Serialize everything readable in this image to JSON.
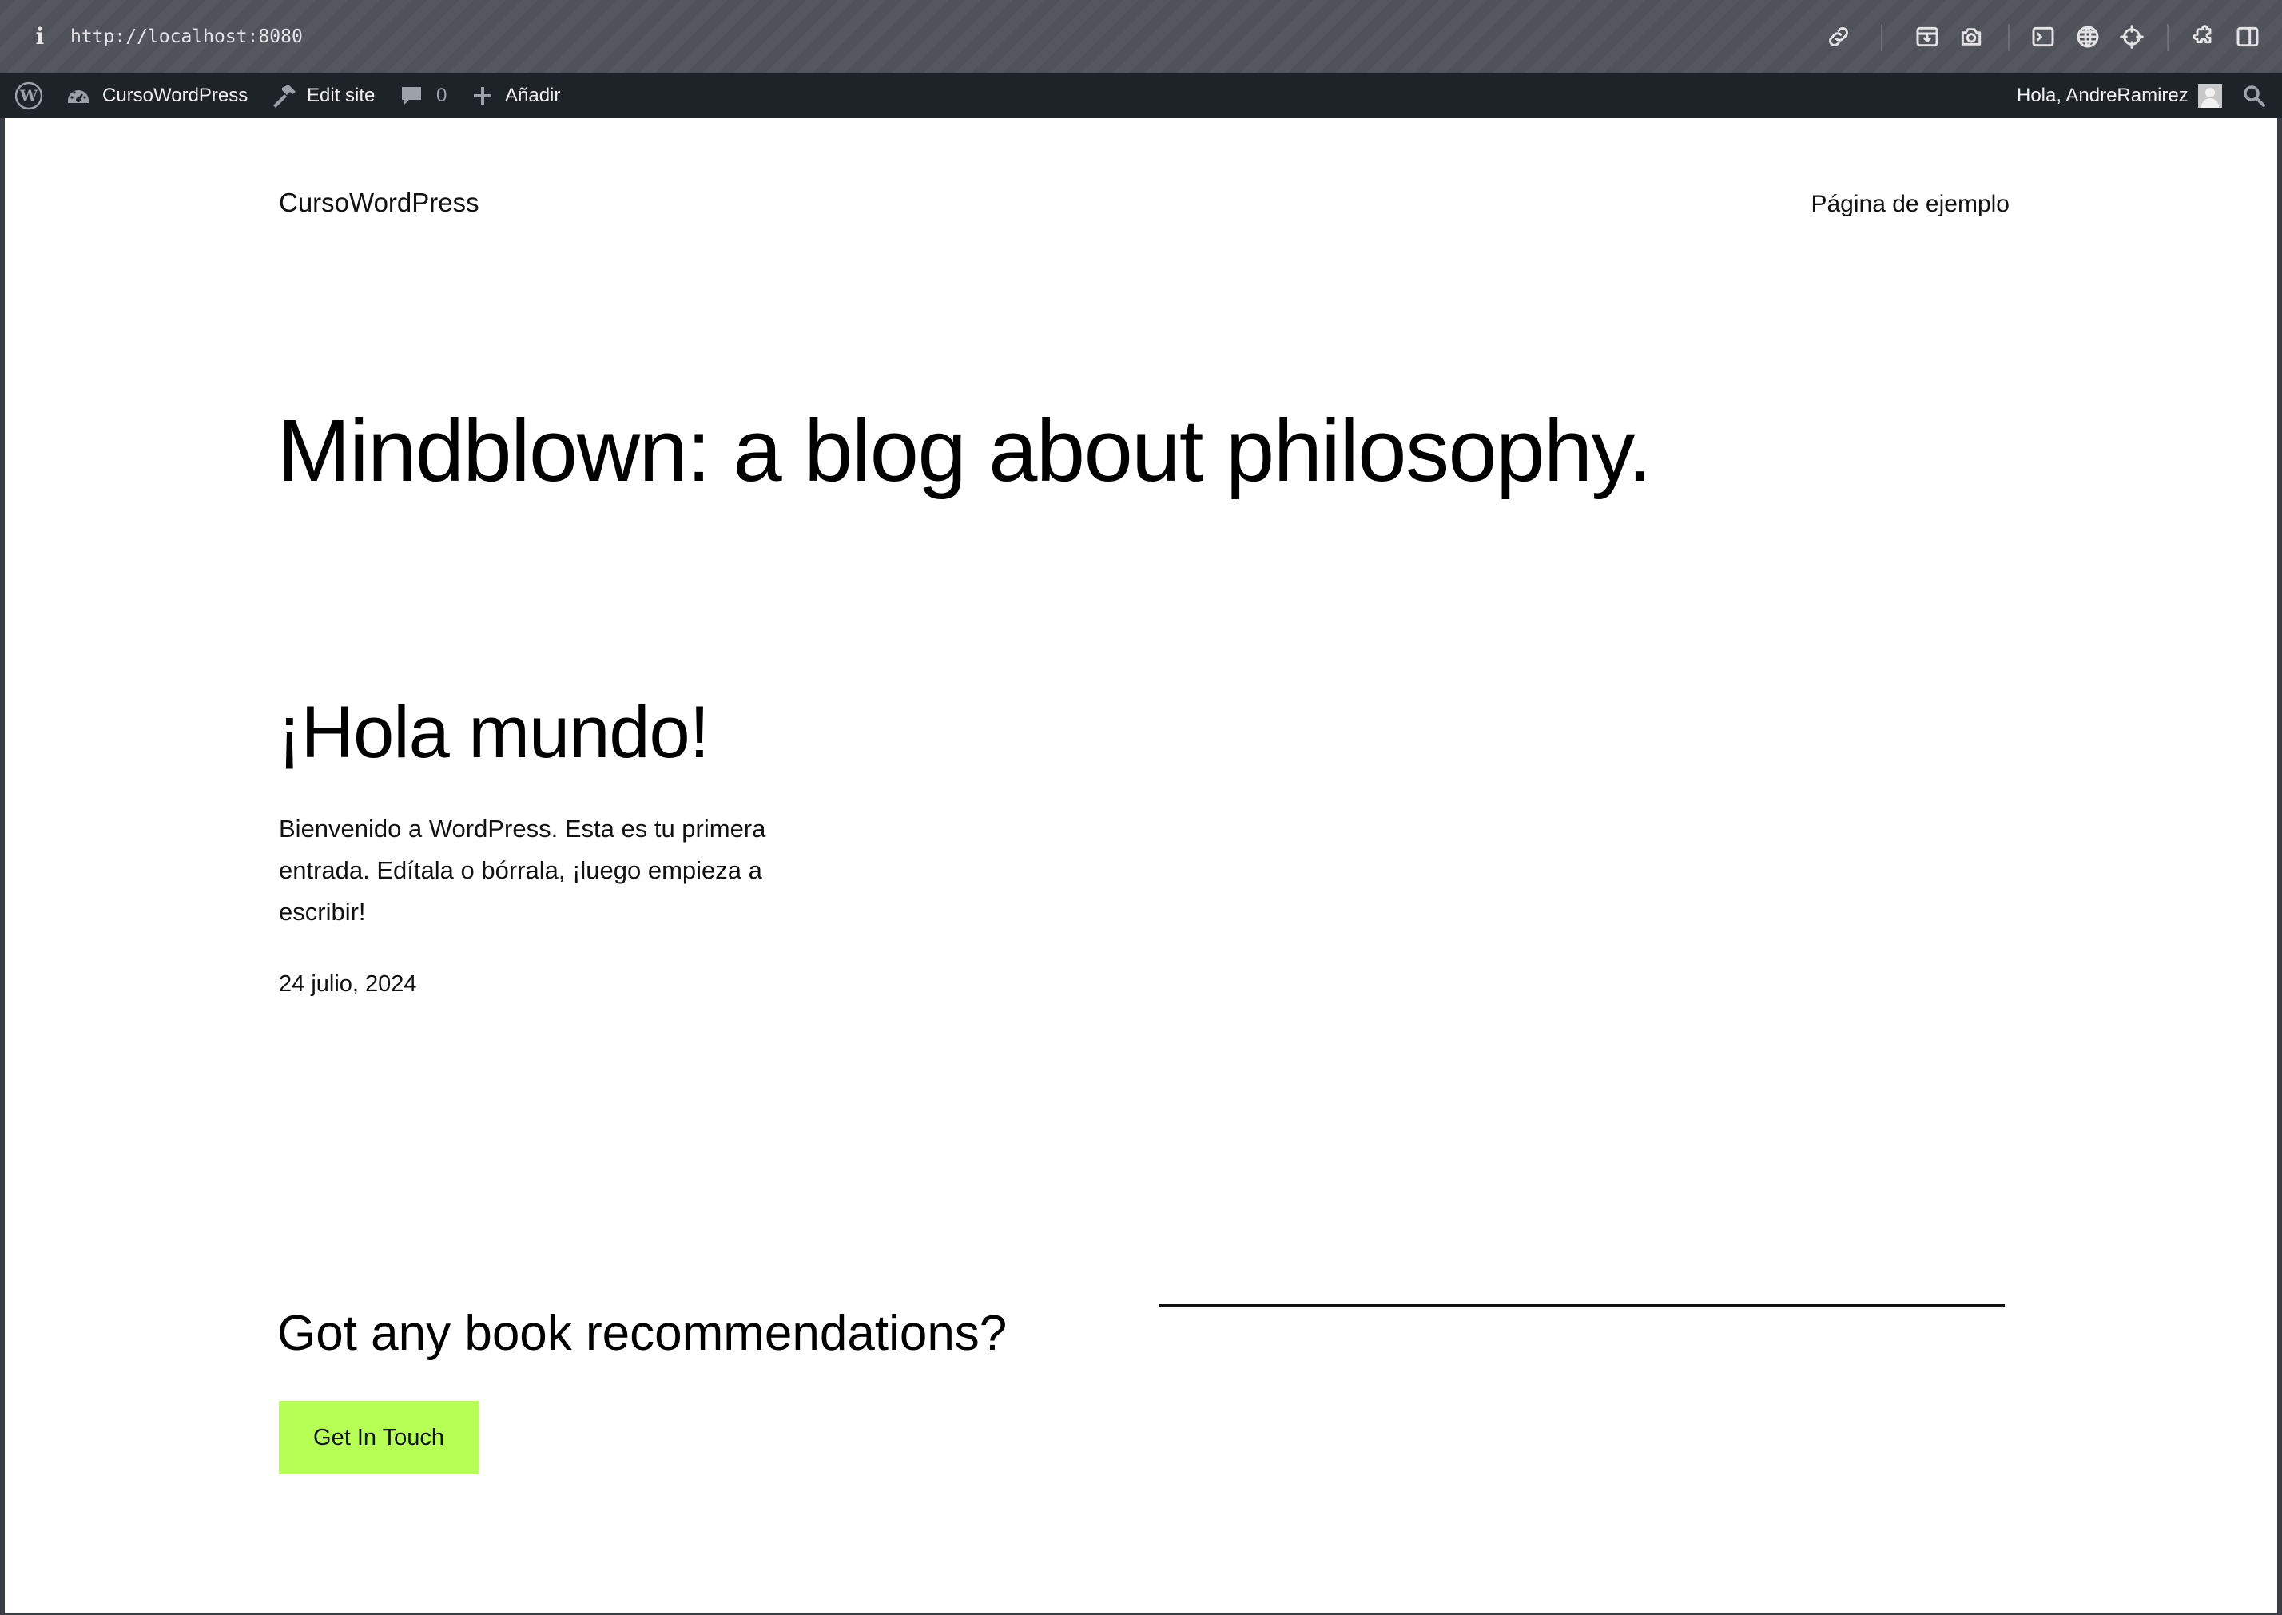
{
  "browser": {
    "info_glyph": "i",
    "url": "http://localhost:8080",
    "toolbar_icons": [
      "link-icon",
      "screenshot-area-icon",
      "camera-icon",
      "terminal-icon",
      "globe-icon",
      "crosshair-icon",
      "extensions-icon",
      "sidebar-icon"
    ]
  },
  "admin_bar": {
    "site_name": "CursoWordPress",
    "edit_site": "Edit site",
    "comments_count": "0",
    "add_new": "Añadir",
    "greeting": "Hola, AndreRamirez"
  },
  "site": {
    "title": "CursoWordPress",
    "nav_link": "Página de ejemplo",
    "hero_heading": "Mindblown: a blog about philosophy."
  },
  "post": {
    "title": "¡Hola mundo!",
    "excerpt": "Bienvenido a WordPress. Esta es tu primera entrada. Edítala o bórrala, ¡luego empieza a escribir!",
    "date": "24 julio, 2024"
  },
  "footer_cta": {
    "heading": "Got any book recommendations?",
    "button_label": "Get In Touch"
  },
  "colors": {
    "admin_bar_bg": "#1d2327",
    "button_bg": "#b6ff55",
    "page_bg": "#ffffff"
  }
}
